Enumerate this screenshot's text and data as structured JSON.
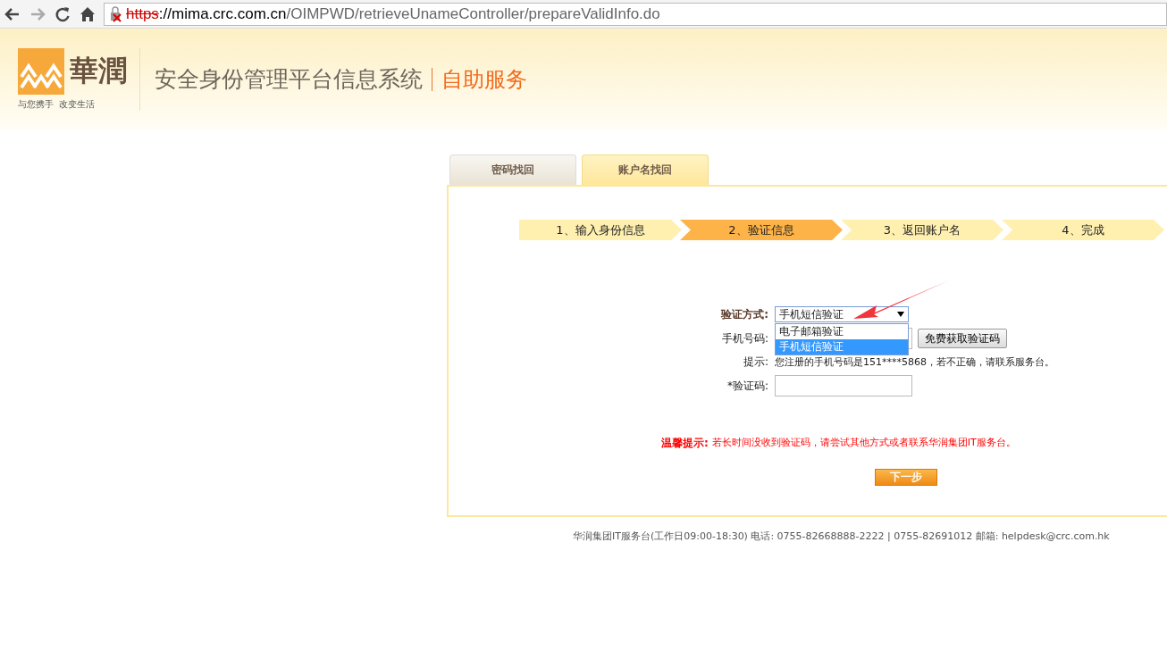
{
  "browser": {
    "url_scheme": "https",
    "url_host": "://mima.crc.com.cn",
    "url_path": "/OIMPWD/retrieveUnameController/prepareValidInfo.do"
  },
  "header": {
    "logo_text": "華潤",
    "slogan": "与您携手  改变生活",
    "system_title": "安全身份管理平台信息系统",
    "service_title": "自助服务"
  },
  "tabs": [
    {
      "label": "密码找回",
      "selected": false
    },
    {
      "label": "账户名找回",
      "selected": true
    }
  ],
  "steps": [
    {
      "label": "1、输入身份信息",
      "selected": false
    },
    {
      "label": "2、验证信息",
      "selected": true
    },
    {
      "label": "3、返回账户名",
      "selected": false
    },
    {
      "label": "4、完成",
      "selected": false
    }
  ],
  "form": {
    "method_label": "验证方式:",
    "method_value": "手机短信验证",
    "options": [
      {
        "label": "电子邮箱验证",
        "selected": false
      },
      {
        "label": "手机短信验证",
        "selected": true
      }
    ],
    "phone_label": "手机号码:",
    "get_code_button": "免费获取验证码",
    "hint_label": "提示:",
    "hint_text": "您注册的手机号码是151****5868，若不正确，请联系服务台。",
    "code_label": "*验证码:"
  },
  "warning": {
    "label": "温馨提示:",
    "text": "若长时间没收到验证码，请尝试其他方式或者联系华润集团IT服务台。"
  },
  "next_button": "下一步",
  "footer": "华润集团IT服务台(工作日09:00-18:30) 电话: 0755-82668888-2222 | 0755-82691012 邮箱: helpdesk@crc.com.hk"
}
